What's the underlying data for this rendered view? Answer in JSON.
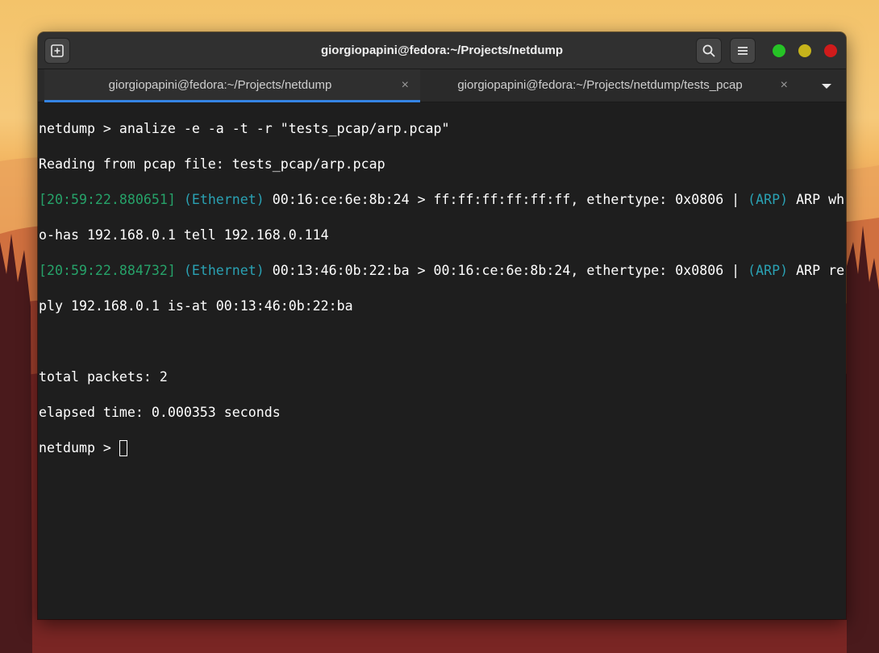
{
  "window": {
    "title": "giorgiopapini@fedora:~/Projects/netdump",
    "buttons": {
      "new_tab_icon": "new-tab-plus-icon",
      "search_icon": "search-icon",
      "menu_icon": "hamburger-menu-icon"
    },
    "controls": {
      "maximize_color": "#26c326",
      "minimize_color": "#c6b31b",
      "close_color": "#d01b1b"
    }
  },
  "tabs": [
    {
      "label": "giorgiopapini@fedora:~/Projects/netdump",
      "close": "×",
      "active": true
    },
    {
      "label": "giorgiopapini@fedora:~/Projects/netdump/tests_pcap",
      "close": "×",
      "active": false
    }
  ],
  "tabs_dropdown_icon": "caret-down-icon",
  "terminal": {
    "prompt": "netdump > ",
    "command": "analize -e -a -t -r \"tests_pcap/arp.pcap\"",
    "reading": "Reading from pcap file: tests_pcap/arp.pcap",
    "packets": [
      {
        "timestamp": "[20:59:22.880651]",
        "l2_proto": "(Ethernet)",
        "l2_info": " 00:16:ce:6e:8b:24 > ff:ff:ff:ff:ff:ff, ethertype: 0x0806 | ",
        "l3_proto": "(ARP)",
        "l3_info_first": " ARP wh",
        "l3_info_wrap": "o-has 192.168.0.1 tell 192.168.0.114"
      },
      {
        "timestamp": "[20:59:22.884732]",
        "l2_proto": "(Ethernet)",
        "l2_info": " 00:13:46:0b:22:ba > 00:16:ce:6e:8b:24, ethertype: 0x0806 | ",
        "l3_proto": "(ARP)",
        "l3_info_first": " ARP re",
        "l3_info_wrap": "ply 192.168.0.1 is-at 00:13:46:0b:22:ba"
      }
    ],
    "total_packets": "total packets: 2",
    "elapsed_time": "elapsed time: 0.000353 seconds",
    "final_prompt": "netdump > "
  },
  "colors": {
    "timestamp": "#26a269",
    "protocol": "#2aa1b3",
    "accent": "#3584e4"
  }
}
